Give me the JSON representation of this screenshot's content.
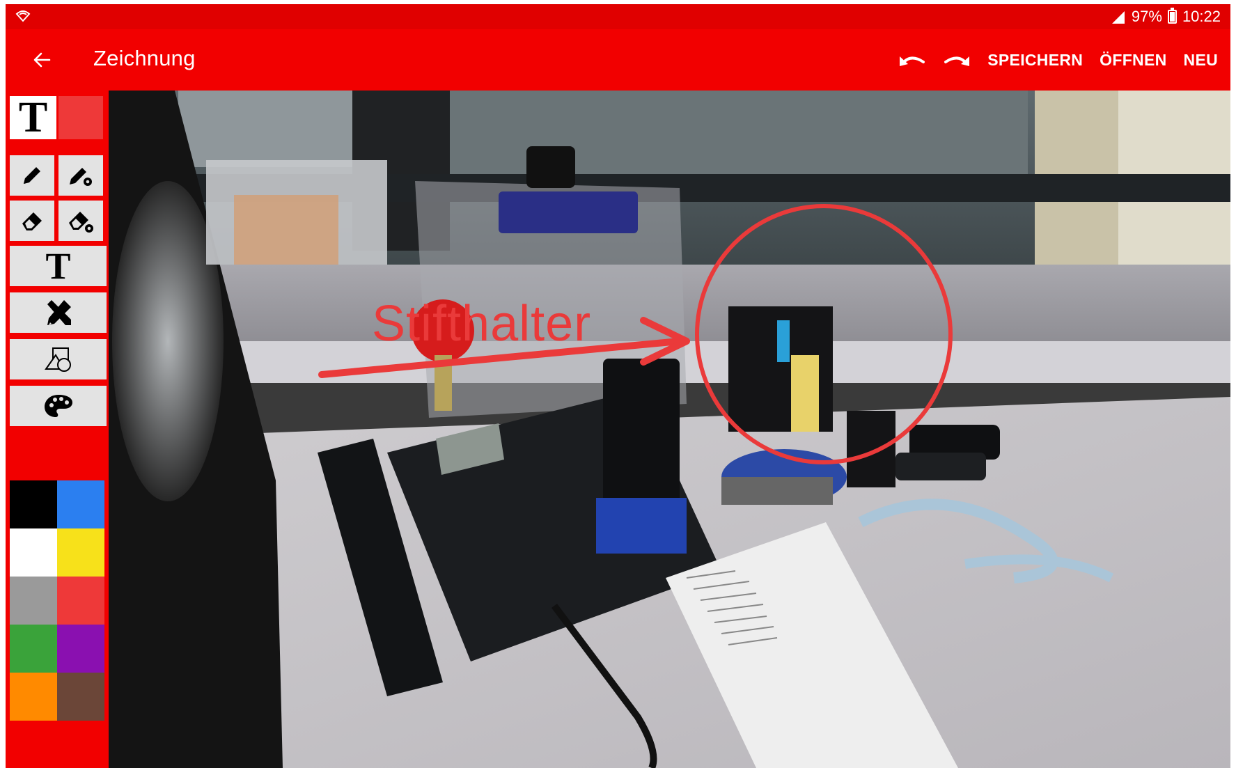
{
  "status_bar": {
    "battery_percent": "97%",
    "time": "10:22",
    "notification_icon": "wifi-signal-icon"
  },
  "action_bar": {
    "back_icon": "arrow-back-icon",
    "title": "Zeichnung",
    "undo_icon": "undo-icon",
    "redo_icon": "redo-icon",
    "save_label": "SPEICHERN",
    "open_label": "ÖFFNEN",
    "new_label": "NEU"
  },
  "sidebar": {
    "current_tool_glyph": "T",
    "current_color": "#ee3939",
    "tools": [
      {
        "name": "pencil-icon"
      },
      {
        "name": "pencil-settings-icon"
      },
      {
        "name": "eraser-icon"
      },
      {
        "name": "eraser-settings-icon"
      },
      {
        "name": "text-tool-icon",
        "glyph": "T"
      },
      {
        "name": "drawing-tools-icon"
      },
      {
        "name": "shapes-icon"
      },
      {
        "name": "palette-icon"
      }
    ],
    "palette": [
      "#000000",
      "#2b7ff0",
      "#ffffff",
      "#f7e11a",
      "#9a9a9a",
      "#ee3939",
      "#3aa33a",
      "#8a10b0",
      "#ff8a00",
      "#6b4638"
    ]
  },
  "canvas": {
    "annotation_text": "Stifthalter",
    "annotation_color": "#ea3a3a"
  }
}
